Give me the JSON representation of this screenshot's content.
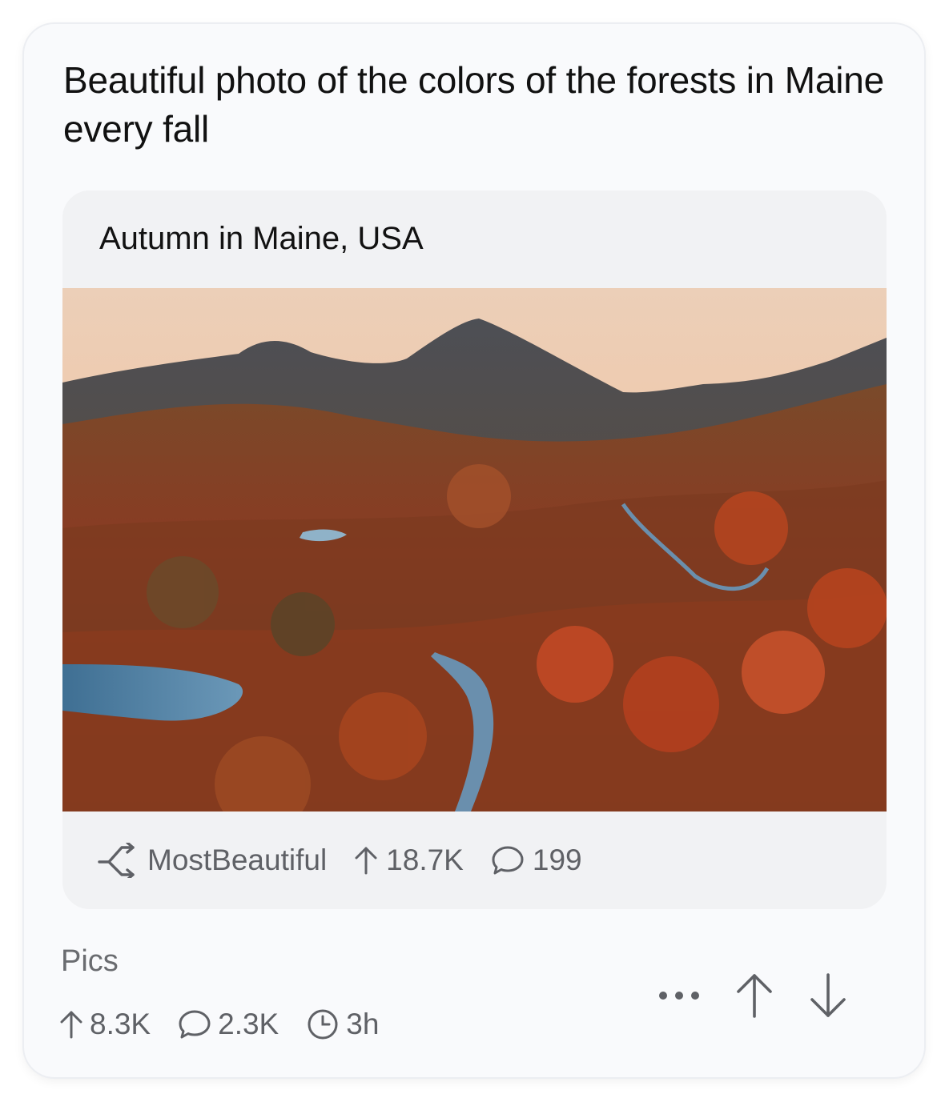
{
  "post": {
    "title": "Beautiful photo of the colors of the forests in Maine every fall",
    "community": "Pics",
    "upvotes": "8.3K",
    "comments": "2.3K",
    "age": "3h"
  },
  "embed": {
    "title": "Autumn in Maine, USA",
    "source": "MostBeautiful",
    "upvotes": "18.7K",
    "comments": "199",
    "image_icon": "landscape-photo"
  },
  "icons": {
    "crosspost": "crosspost-icon",
    "upvote": "arrow-up-icon",
    "comment": "comment-bubble-icon",
    "clock": "clock-icon",
    "more": "ellipsis-icon",
    "vote_up": "upvote-arrow-icon",
    "vote_down": "downvote-arrow-icon"
  },
  "colors": {
    "card_bg": "#f9fafc",
    "embed_bg": "#f1f2f4",
    "text_primary": "#111111",
    "text_secondary": "#5f6166"
  }
}
